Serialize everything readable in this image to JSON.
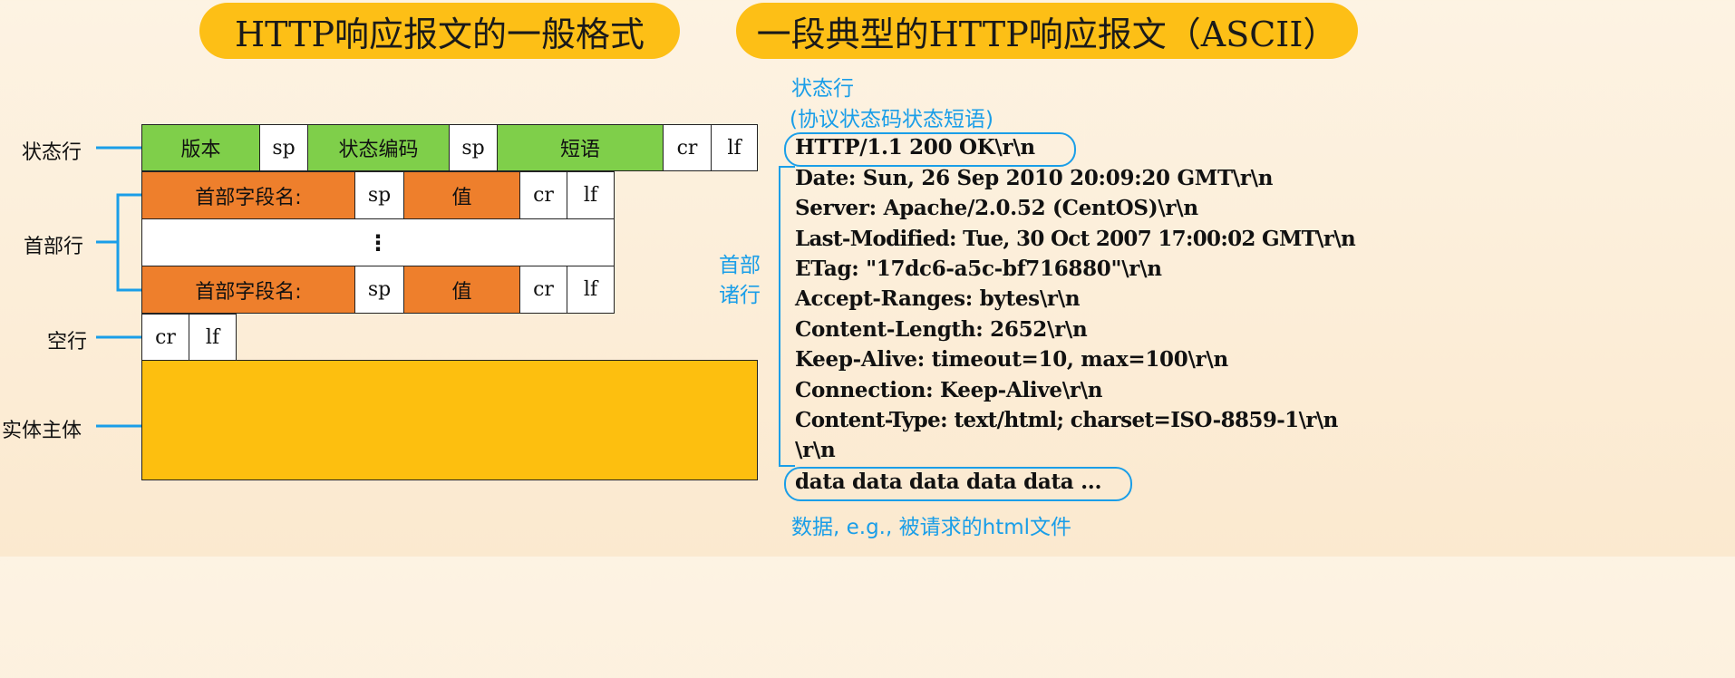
{
  "titles": {
    "left": "HTTP响应报文的一般格式",
    "right": "一段典型的HTTP响应报文（ASCII）"
  },
  "format": {
    "row_labels": {
      "status": "状态行",
      "header": "首部行",
      "blank": "空行",
      "body": "实体主体"
    },
    "status_row": {
      "version": "版本",
      "sp1": "sp",
      "status_code": "状态编码",
      "sp2": "sp",
      "phrase": "短语",
      "cr": "cr",
      "lf": "lf"
    },
    "header_row": {
      "name": "首部字段名:",
      "sp": "sp",
      "value": "值",
      "cr": "cr",
      "lf": "lf"
    },
    "ellipsis": "⋮",
    "blank_row": {
      "cr": "cr",
      "lf": "lf"
    }
  },
  "example": {
    "status_note_line1": "状态行",
    "status_note_line2": "(协议状态码状态短语)",
    "status_line": "HTTP/1.1 200 OK\\r\\n",
    "header_note_line1": "首部",
    "header_note_line2": "诸行",
    "header_lines": [
      "Date: Sun, 26 Sep 2010 20:09:20 GMT\\r\\n",
      "Server: Apache/2.0.52 (CentOS)\\r\\n",
      "Last-Modified: Tue, 30 Oct 2007 17:00:02 GMT\\r\\n",
      "ETag: \"17dc6-a5c-bf716880\"\\r\\n",
      "Accept-Ranges: bytes\\r\\n",
      "Content-Length: 2652\\r\\n",
      "Keep-Alive: timeout=10, max=100\\r\\n",
      "Connection: Keep-Alive\\r\\n",
      "Content-Type: text/html; charset=ISO-8859-1\\r\\n",
      "\\r\\n"
    ],
    "data_line": "data data data data data ...",
    "data_note": "数据, e.g., 被请求的html文件"
  },
  "colors": {
    "title_bg": "#fdbf16",
    "green": "#7fcf4a",
    "orange": "#ee7f2c",
    "gold": "#fdbf0f",
    "blue": "#1a9ee8"
  }
}
